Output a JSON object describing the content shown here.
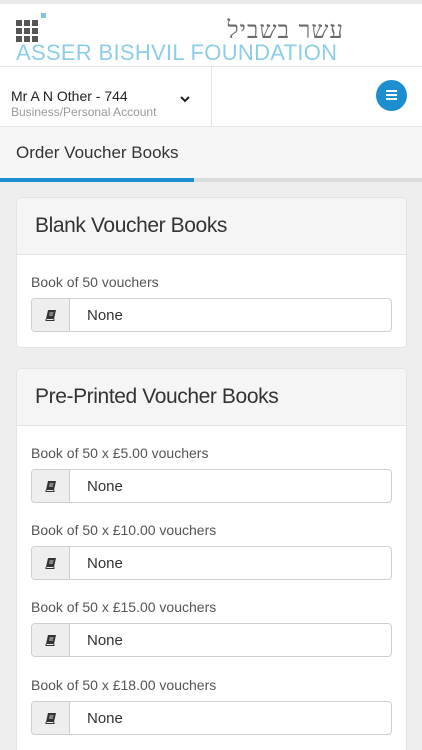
{
  "brand": {
    "hebrew_name": "עשר בשביל",
    "english_name": "ASSER BISHVIL FOUNDATION",
    "accent_color": "#8ccde8"
  },
  "account": {
    "name": "Mr A N Other - 744",
    "type": "Business/Personal Account"
  },
  "menu": {
    "icon": "hamburger-icon",
    "color": "#1d8fd1"
  },
  "tabs": [
    {
      "label": "Order Voucher Books",
      "active": true
    }
  ],
  "sections": [
    {
      "title": "Blank Voucher Books",
      "fields": [
        {
          "label": "Book of 50 vouchers",
          "value": "None",
          "icon": "book-icon"
        }
      ]
    },
    {
      "title": "Pre-Printed Voucher Books",
      "fields": [
        {
          "label": "Book of 50 x £5.00 vouchers",
          "value": "None",
          "icon": "book-icon"
        },
        {
          "label": "Book of 50 x £10.00 vouchers",
          "value": "None",
          "icon": "book-icon"
        },
        {
          "label": "Book of 50 x £15.00 vouchers",
          "value": "None",
          "icon": "book-icon"
        },
        {
          "label": "Book of 50 x £18.00 vouchers",
          "value": "None",
          "icon": "book-icon"
        }
      ]
    }
  ]
}
